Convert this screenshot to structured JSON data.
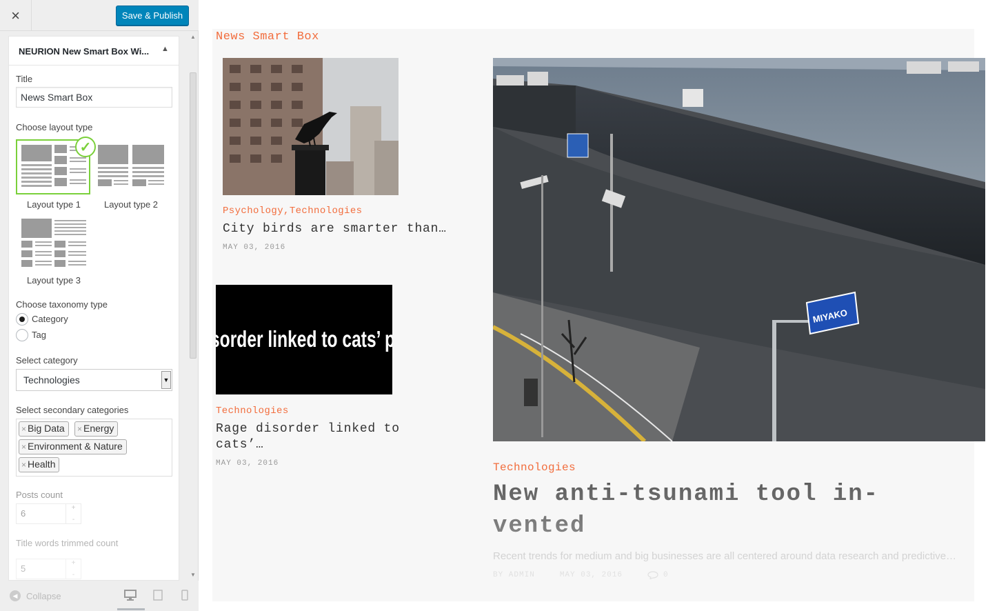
{
  "topbar": {
    "close_label": "×",
    "publish_label": "Save & Publish"
  },
  "widget": {
    "title": "NEURION New Smart Box Wi...",
    "toggle": "▲",
    "title_label": "Title",
    "title_value": "News Smart Box",
    "layout_label": "Choose layout type",
    "layouts": [
      {
        "label": "Layout type 1",
        "selected": true
      },
      {
        "label": "Layout type 2",
        "selected": false
      },
      {
        "label": "Layout type 3",
        "selected": false
      }
    ],
    "check_mark": "✓",
    "taxonomy_label": "Choose taxonomy type",
    "taxonomy_options": [
      {
        "label": "Category",
        "checked": true
      },
      {
        "label": "Tag",
        "checked": false
      }
    ],
    "category_label": "Select category",
    "category_value": "Technologies",
    "category_arrow": "▼",
    "secondary_label": "Select secondary categories",
    "secondary_tags": [
      "Big Data",
      "Energy",
      "Environment & Nature",
      "Health"
    ],
    "tag_remove": "×",
    "posts_count_label": "Posts count",
    "posts_count_value": "6",
    "title_words_label": "Title words trimmed count",
    "title_words_value": "5",
    "spin_up": "+",
    "spin_down": "-"
  },
  "footer": {
    "collapse_label": "Collapse",
    "collapse_icon": "◀"
  },
  "preview": {
    "section_title": "News Smart Box",
    "posts": [
      {
        "categories": [
          "Psychology",
          "Technologies"
        ],
        "separator": ",",
        "title": "City birds are smarter than…",
        "date": "MAY 03, 2016"
      },
      {
        "categories": [
          "Technologies"
        ],
        "title_line1": "Rage disorder linked to",
        "title_line2": "cats’…",
        "date": "MAY 03, 2016",
        "image_text": "sorder linked to cats’ p"
      }
    ],
    "featured": {
      "category": "Technologies",
      "title_line1": "New anti-tsunami tool in-",
      "title_line2": "vented",
      "excerpt": "Recent trends for medium and big businesses are all centered around data research and predictive…",
      "author": "BY ADMIN",
      "date": "MAY 03, 2016",
      "comments": "0",
      "sign_text": "MIYAKO"
    }
  }
}
